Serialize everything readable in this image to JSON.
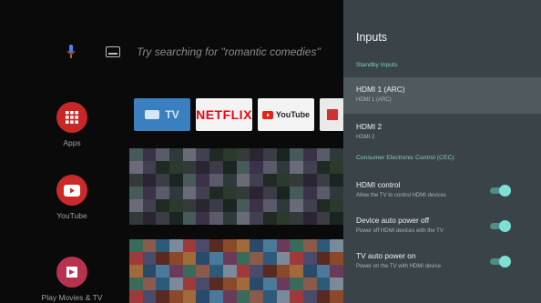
{
  "search": {
    "placeholder_text": "Try searching for \"romantic comedies\"",
    "mic_icon": "mic-icon",
    "keyboard_icon": "keyboard-icon"
  },
  "sidebar_apps": [
    {
      "label": "Apps",
      "icon": "apps-grid-icon"
    },
    {
      "label": "YouTube",
      "icon": "youtube-icon"
    },
    {
      "label": "Play Movies & TV",
      "icon": "play-movies-icon"
    }
  ],
  "app_row": [
    {
      "label": "TV"
    },
    {
      "label": "NETFLIX"
    },
    {
      "label": "YouTube"
    }
  ],
  "panel": {
    "title": "Inputs",
    "standby_label": "Standby Inputs",
    "inputs": [
      {
        "title": "HDMI 1 (ARC)",
        "subtitle": "HDMI 1 (ARC)"
      },
      {
        "title": "HDMI 2",
        "subtitle": "HDMI 2"
      }
    ],
    "cec_label": "Consumer Electronic Control (CEC)",
    "cec_items": [
      {
        "title": "HDMI control",
        "subtitle": "Allow the TV to control HDMI devices",
        "enabled": true
      },
      {
        "title": "Device auto power off",
        "subtitle": "Power off HDMI devices with the TV",
        "enabled": true
      },
      {
        "title": "TV auto power on",
        "subtitle": "Power on the TV with HDMI device",
        "enabled": true
      }
    ]
  },
  "colors": {
    "panel_bg": "#3a4448",
    "accent": "#80cbc4",
    "toggle_on": "#7ee0d4"
  }
}
